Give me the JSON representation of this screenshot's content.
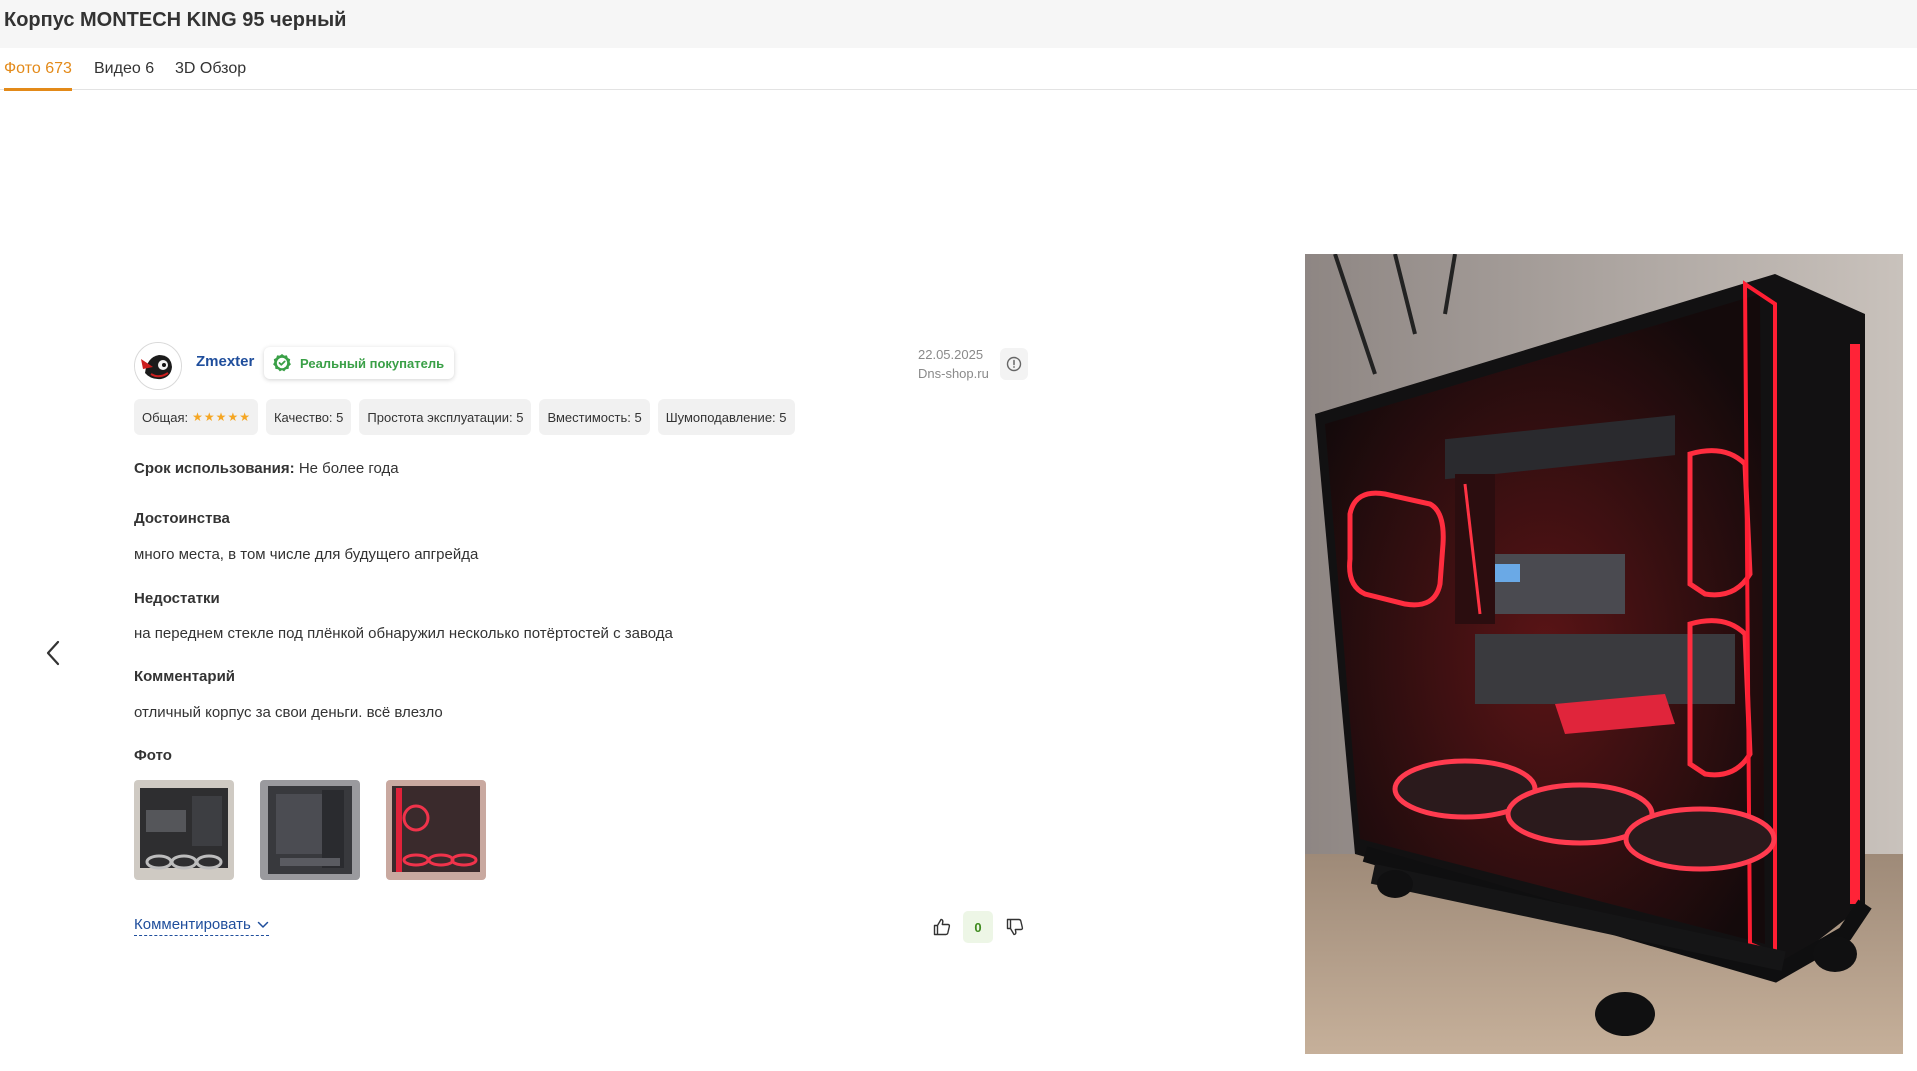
{
  "header": {
    "title": "Корпус MONTECH KING 95 черный"
  },
  "tabs": [
    {
      "label": "Фото 673",
      "active": true
    },
    {
      "label": "Видео 6",
      "active": false
    },
    {
      "label": "3D Обзор",
      "active": false
    }
  ],
  "review": {
    "author": "Zmexter",
    "badge": "Реальный покупатель",
    "date": "22.05.2025",
    "source": "Dns-shop.ru",
    "overall": {
      "label": "Общая:",
      "stars": 5,
      "max": 5
    },
    "ratings": [
      "Качество: 5",
      "Простота эксплуатации: 5",
      "Вместимость: 5",
      "Шумоподавление: 5"
    ],
    "usage": {
      "label": "Срок использования:",
      "value": "Не более года"
    },
    "pros": {
      "title": "Достоинства",
      "text": "много места, в том числе для будущего апгрейда"
    },
    "cons": {
      "title": "Недостатки",
      "text": "на переднем стекле под плёнкой обнаружил несколько потёртостей с завода"
    },
    "comment": {
      "title": "Комментарий",
      "text": "отличный корпус за свои деньги. всё влезло"
    },
    "photos_title": "Фото",
    "photo_count": 3,
    "comment_link": "Комментировать",
    "votes": "0"
  },
  "icons": {
    "prev": "chevron-left-icon",
    "info": "info-icon",
    "like": "thumbs-up-icon",
    "dislike": "thumbs-down-icon",
    "badge": "verified-check-icon"
  },
  "colors": {
    "accent": "#e38a19",
    "link": "#1f4e9c",
    "badge": "#3aa047",
    "star": "#f5a623"
  }
}
